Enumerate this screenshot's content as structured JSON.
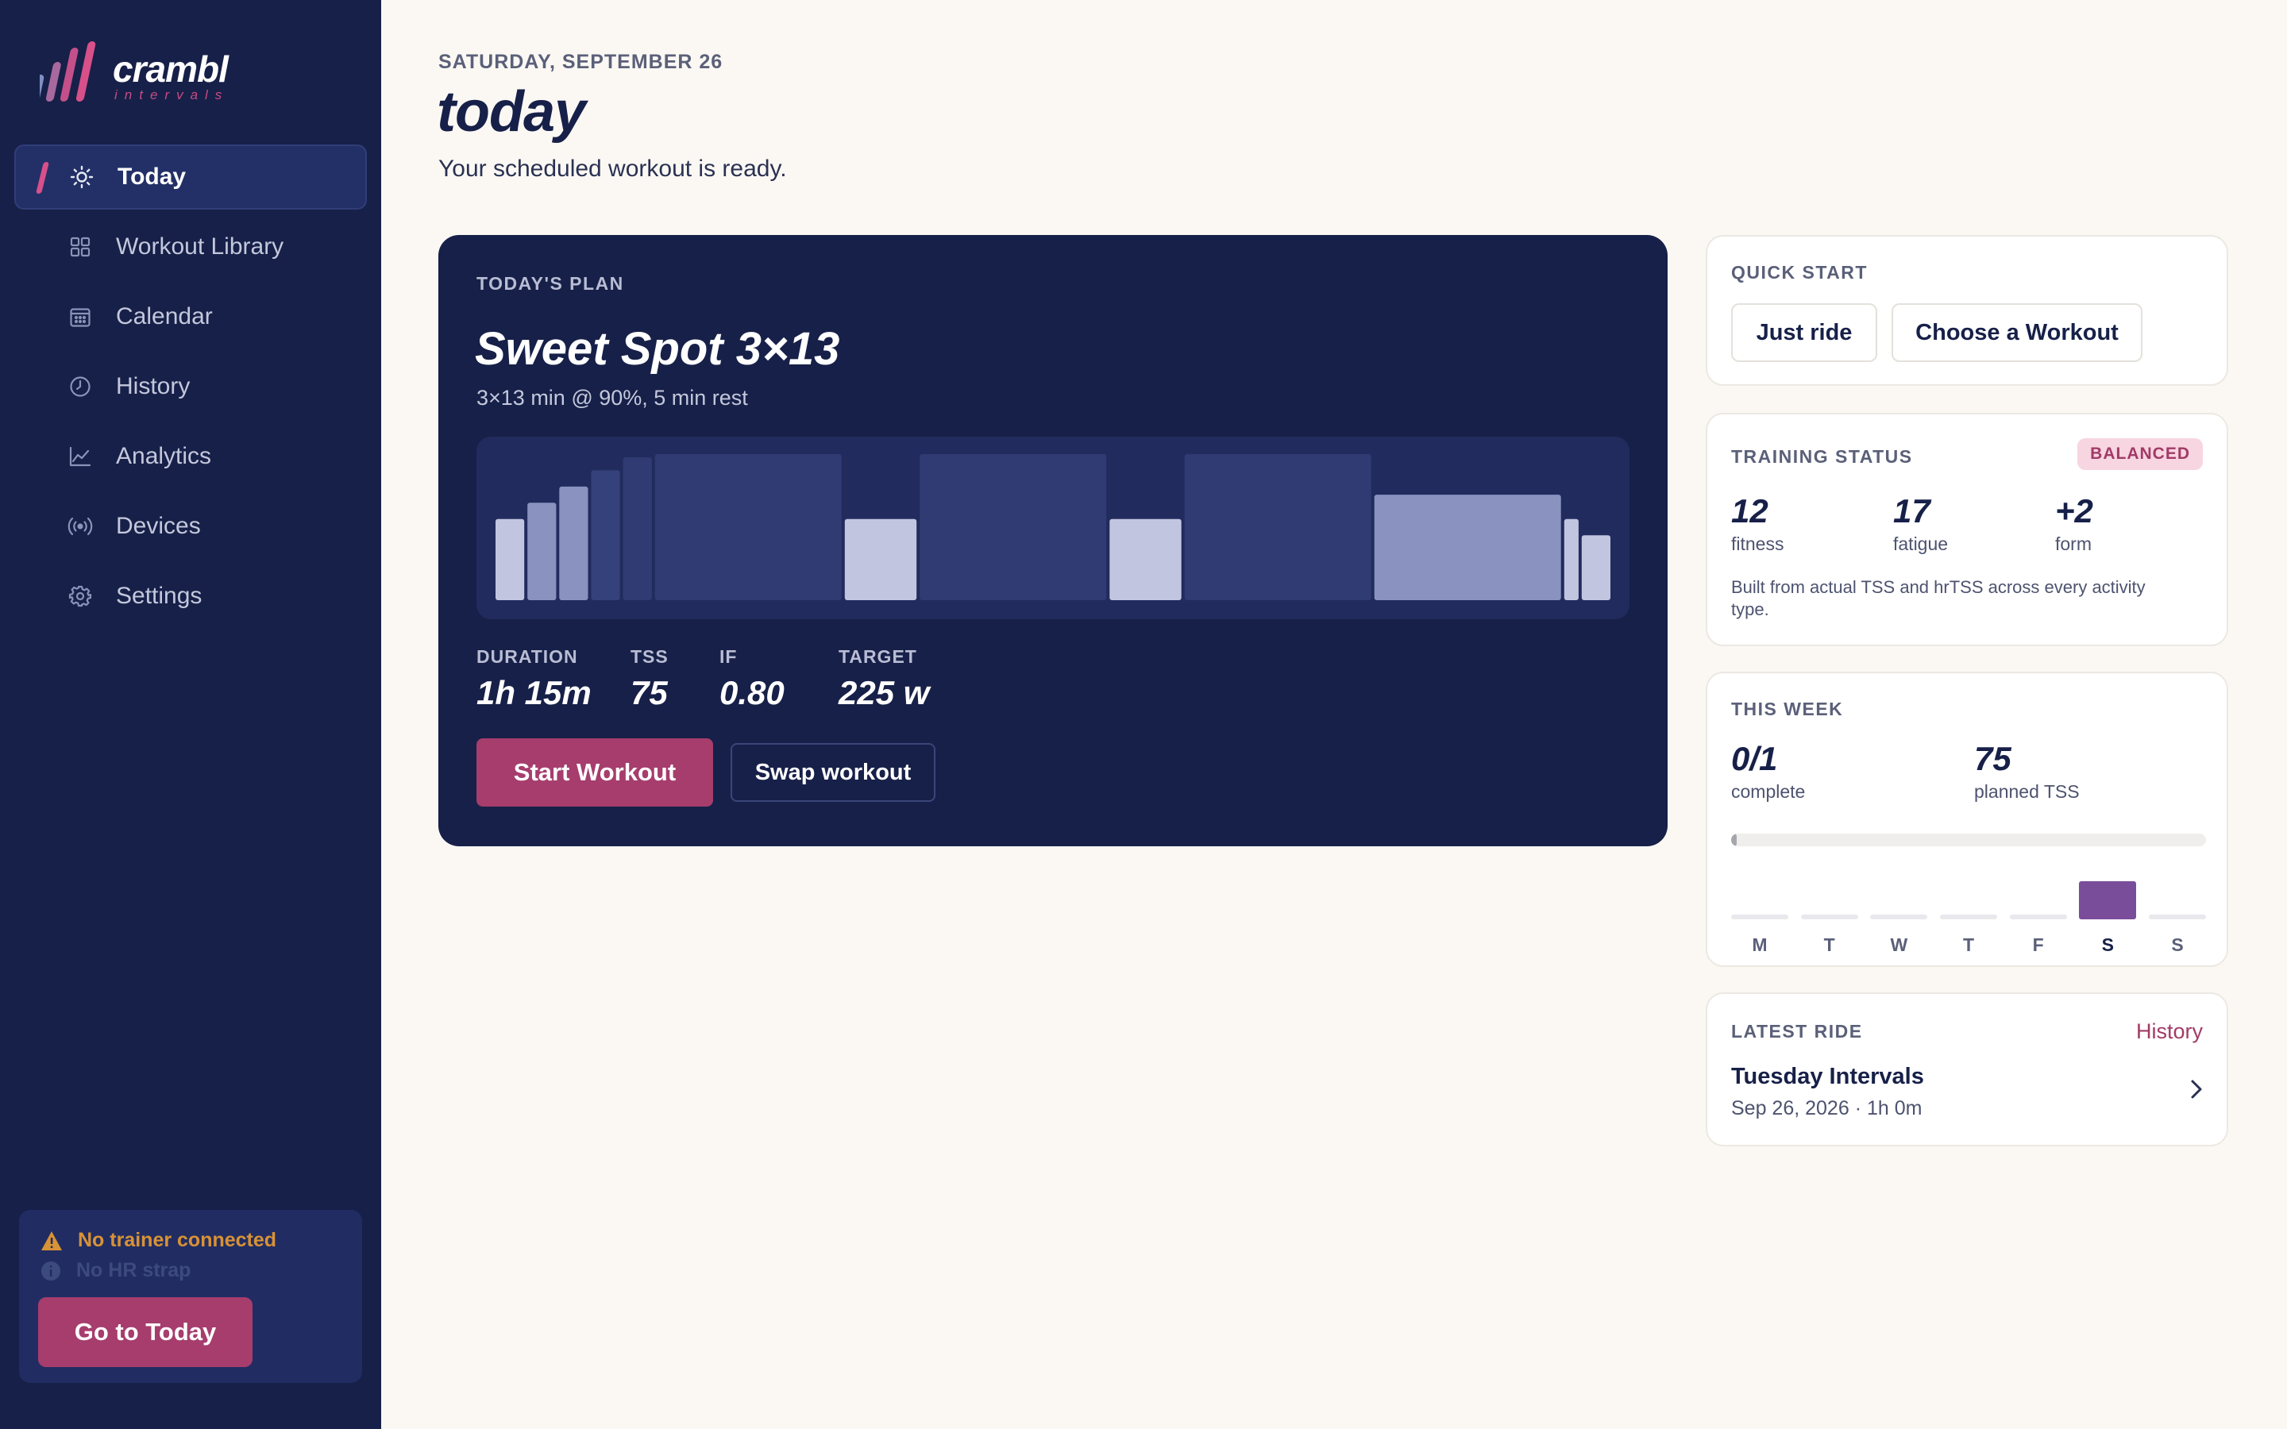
{
  "app": {
    "logo_text": "crambl",
    "logo_subtext": "intervals",
    "brand_color": "#172048",
    "accent_color": "#a63d6d"
  },
  "sidebar": {
    "items": [
      {
        "label": "Today",
        "icon": "sun-icon",
        "active": true
      },
      {
        "label": "Workout Library",
        "icon": "grid-icon",
        "active": false
      },
      {
        "label": "Calendar",
        "icon": "calendar-icon",
        "active": false
      },
      {
        "label": "History",
        "icon": "clock-icon",
        "active": false
      },
      {
        "label": "Analytics",
        "icon": "line-chart-icon",
        "active": false
      },
      {
        "label": "Devices",
        "icon": "broadcast-icon",
        "active": false
      },
      {
        "label": "Settings",
        "icon": "gear-icon",
        "active": false
      }
    ],
    "status": {
      "trainer": "No trainer connected",
      "hr": "No HR strap",
      "button": "Go to Today"
    }
  },
  "header": {
    "date": "SATURDAY, SEPTEMBER 26",
    "title": "today",
    "subtitle": "Your scheduled workout is ready."
  },
  "plan": {
    "kicker": "TODAY'S PLAN",
    "name": "Sweet Spot 3×13",
    "description": "3×13 min @ 90%, 5 min rest",
    "profile_segments": [
      {
        "minutes": 2,
        "intensity": 0.5
      },
      {
        "minutes": 2,
        "intensity": 0.6
      },
      {
        "minutes": 2,
        "intensity": 0.7
      },
      {
        "minutes": 2,
        "intensity": 0.8
      },
      {
        "minutes": 2,
        "intensity": 0.88
      },
      {
        "minutes": 13,
        "intensity": 0.9
      },
      {
        "minutes": 5,
        "intensity": 0.5
      },
      {
        "minutes": 13,
        "intensity": 0.9
      },
      {
        "minutes": 5,
        "intensity": 0.5
      },
      {
        "minutes": 13,
        "intensity": 0.9
      },
      {
        "minutes": 13,
        "intensity": 0.65
      },
      {
        "minutes": 1,
        "intensity": 0.5
      },
      {
        "minutes": 2,
        "intensity": 0.4
      }
    ],
    "stats": [
      {
        "label": "DURATION",
        "value": "1h 15m"
      },
      {
        "label": "TSS",
        "value": "75"
      },
      {
        "label": "IF",
        "value": "0.80"
      },
      {
        "label": "TARGET",
        "value": "225 w"
      }
    ],
    "start_button": "Start Workout",
    "swap_button": "Swap workout"
  },
  "quick_start": {
    "kicker": "QUICK START",
    "buttons": [
      "Just ride",
      "Choose a Workout"
    ]
  },
  "training_status": {
    "kicker": "TRAINING STATUS",
    "badge": "BALANCED",
    "metrics": [
      {
        "value": "12",
        "label": "fitness"
      },
      {
        "value": "17",
        "label": "fatigue"
      },
      {
        "value": "+2",
        "label": "form"
      }
    ],
    "note": "Built from actual TSS and hrTSS across every activity type."
  },
  "this_week": {
    "kicker": "THIS WEEK",
    "complete_value": "0/1",
    "complete_label": "complete",
    "tss_value": "75",
    "tss_label": "planned TSS",
    "progress": 0.01,
    "days": [
      {
        "label": "M",
        "planned": false,
        "current": false
      },
      {
        "label": "T",
        "planned": false,
        "current": false
      },
      {
        "label": "W",
        "planned": false,
        "current": false
      },
      {
        "label": "T",
        "planned": false,
        "current": false
      },
      {
        "label": "F",
        "planned": false,
        "current": false
      },
      {
        "label": "S",
        "planned": true,
        "current": true
      },
      {
        "label": "S",
        "planned": false,
        "current": false
      }
    ]
  },
  "latest_ride": {
    "kicker": "LATEST RIDE",
    "history_link": "History",
    "name": "Tuesday Intervals",
    "meta": "Sep 26, 2026 · 1h 0m"
  }
}
